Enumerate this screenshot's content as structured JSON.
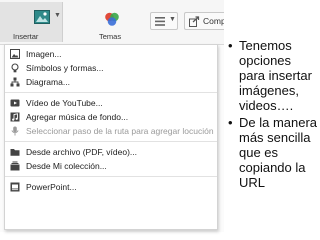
{
  "toolbar": {
    "insert_label": "Insertar",
    "themes_label": "Temas",
    "share_label": "Compa"
  },
  "insert_menu": {
    "items": [
      {
        "label": "Imagen...",
        "icon": "image-icon",
        "enabled": true
      },
      {
        "label": "Símbolos y formas...",
        "icon": "lightbulb-icon",
        "enabled": true
      },
      {
        "label": "Diagrama...",
        "icon": "diagram-icon",
        "enabled": true
      },
      {
        "label": "Vídeo de YouTube...",
        "icon": "video-icon",
        "enabled": true
      },
      {
        "label": "Agregar música de fondo...",
        "icon": "music-icon",
        "enabled": true
      },
      {
        "label": "Seleccionar paso de la ruta para agregar locución",
        "icon": "microphone-icon",
        "enabled": false
      },
      {
        "label": "Desde archivo (PDF, vídeo)...",
        "icon": "folder-icon",
        "enabled": true
      },
      {
        "label": "Desde Mi colección...",
        "icon": "collection-icon",
        "enabled": true
      },
      {
        "label": "PowerPoint...",
        "icon": "powerpoint-icon",
        "enabled": true
      }
    ]
  },
  "notes": {
    "bullets": [
      "Tenemos opciones para insertar imágenes, videos….",
      "De la manera más sencilla que es copiando la URL"
    ]
  },
  "colors": {
    "menu_text": "#222222",
    "disabled_text": "#9a9a9a",
    "themes_red": "#e04a3a",
    "themes_green": "#3aa64a",
    "themes_blue": "#3a6fd8",
    "insert_icon": "#2f8a8a"
  }
}
